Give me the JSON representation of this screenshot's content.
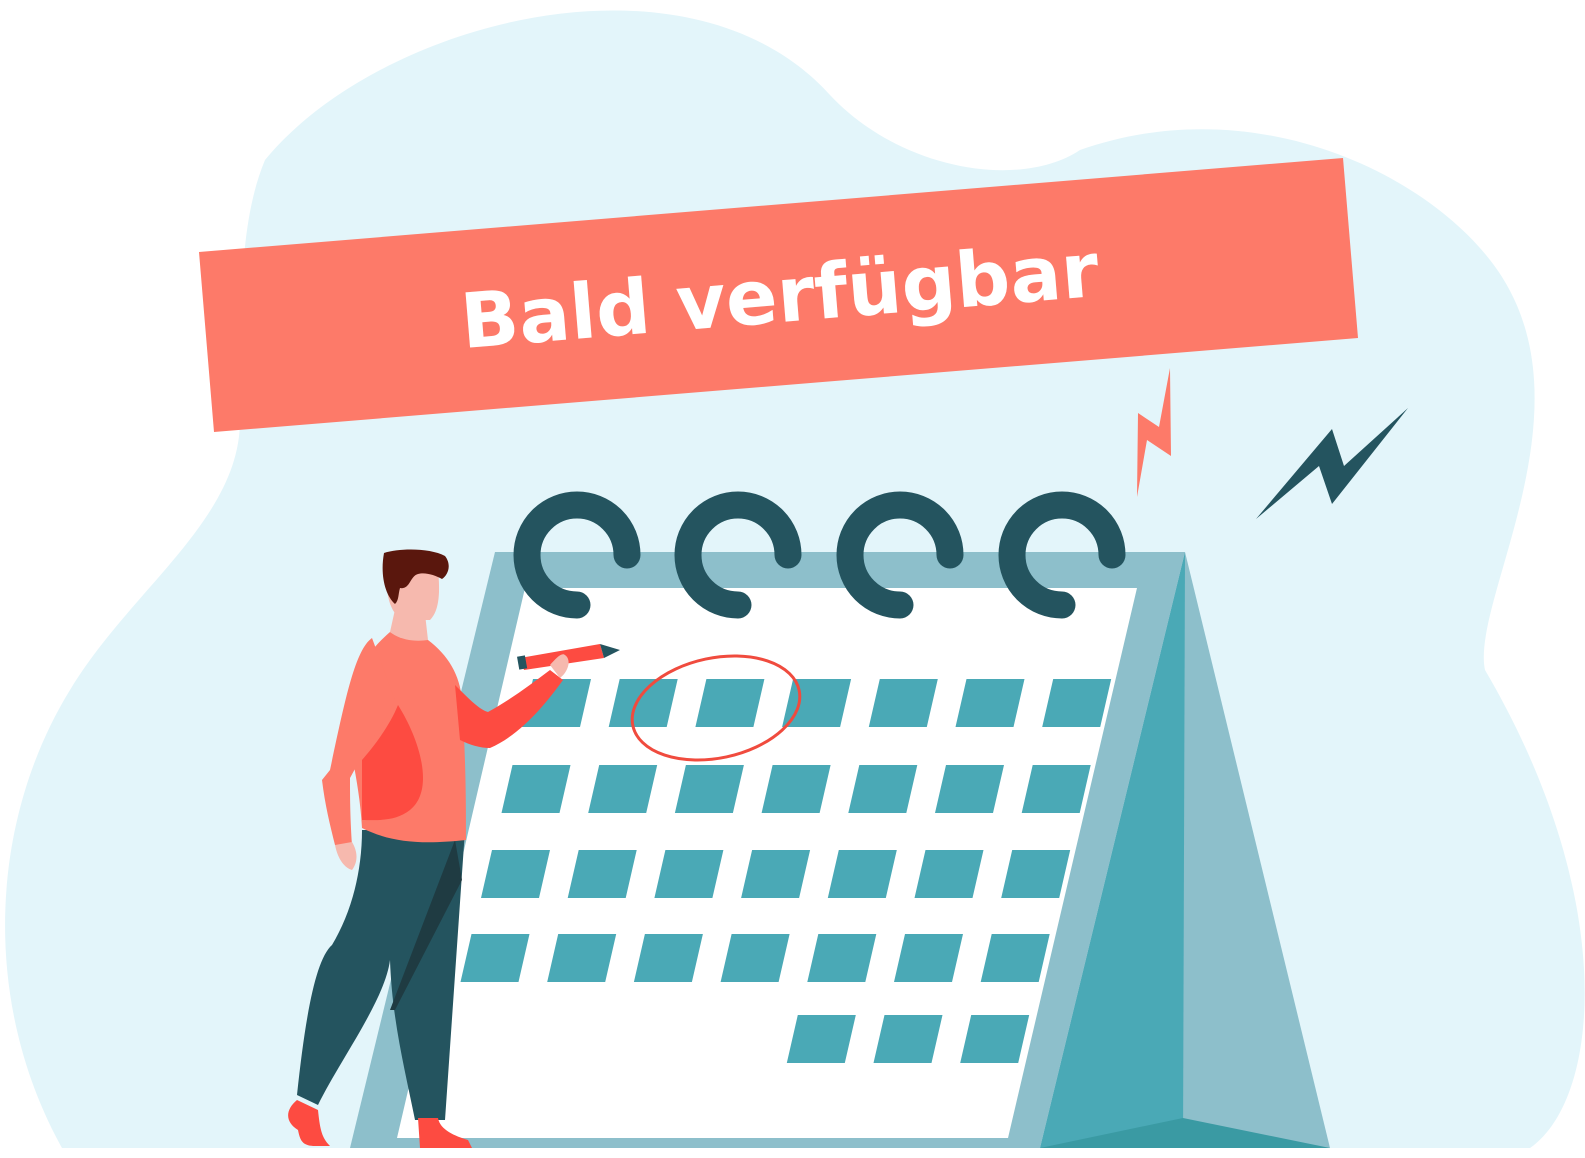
{
  "banner": {
    "text": "Bald verfügbar"
  },
  "colors": {
    "background_blob": "#e3f5fa",
    "banner": "#fd7a69",
    "calendar_side": "#8dbfcb",
    "calendar_teal": "#4aa9b6",
    "calendar_dark": "#24545f",
    "highlight_circle": "#f04b3e",
    "person_shirt": "#fd7a69",
    "person_pants": "#24545f",
    "person_hair": "#5a170d",
    "person_skin": "#f6b9ae"
  },
  "calendar": {
    "rings": 4,
    "day_rows": [
      7,
      7,
      7,
      7,
      3
    ],
    "circled_cell": "row-1-col-3"
  },
  "icons": [
    "lightning-bolt-icon",
    "lightning-bolt-icon",
    "pencil-icon",
    "calendar-icon"
  ]
}
